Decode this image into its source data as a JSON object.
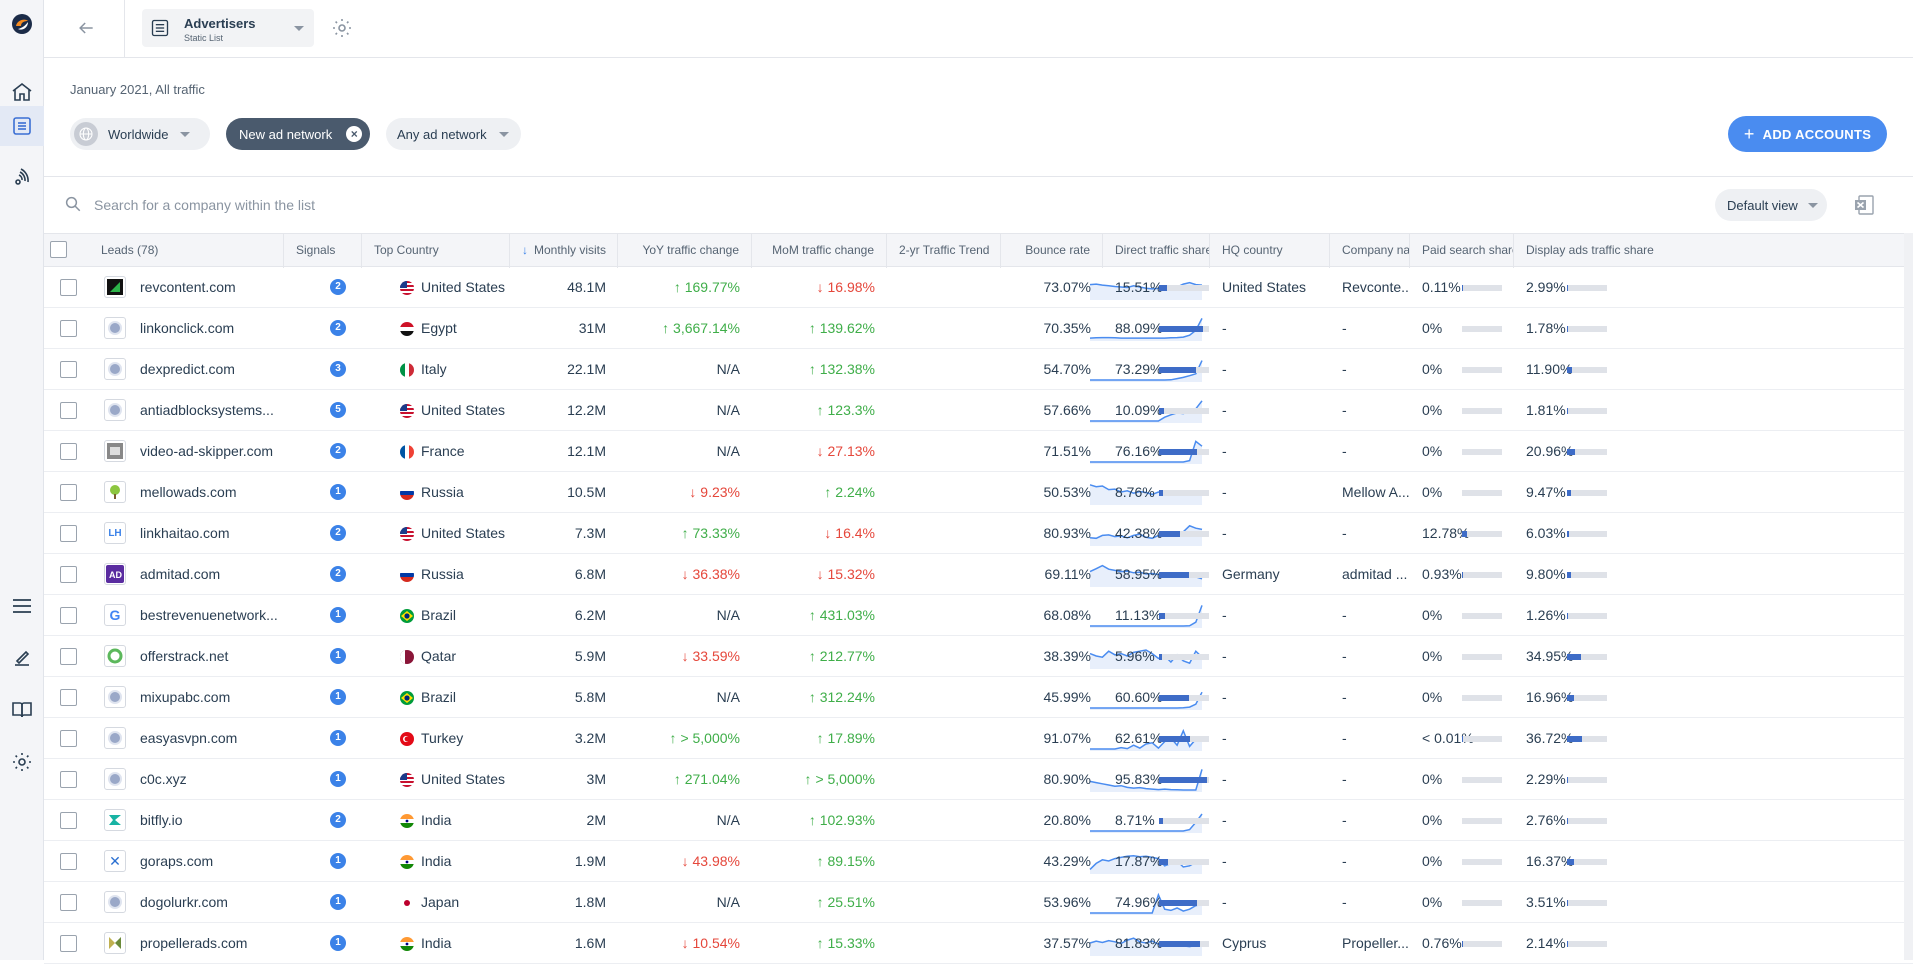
{
  "colors": {
    "accent": "#4a8cf0",
    "up": "#3fae49",
    "down": "#e5473b",
    "bar": "#3e6cc7",
    "signal": "#3b82e8"
  },
  "rail": {
    "icons": [
      "similarweb-logo-icon",
      "home-icon",
      "list-icon",
      "signals-icon",
      "menu-icon",
      "edit-icon",
      "book-icon",
      "settings-icon"
    ]
  },
  "header": {
    "list_title": "Advertisers",
    "list_subtitle": "Static List"
  },
  "filters": {
    "period": "January 2021, All traffic",
    "region": "Worldwide",
    "active_chip": "New ad network",
    "network_select": "Any ad network",
    "add_button": "ADD ACCOUNTS"
  },
  "search": {
    "placeholder": "Search for a company within the list",
    "view": "Default view"
  },
  "columns": {
    "leads": "Leads (78)",
    "signals": "Signals",
    "top_country": "Top Country",
    "monthly_visits": "Monthly visits",
    "yoy": "YoY traffic change",
    "mom": "MoM traffic change",
    "trend": "2-yr Traffic Trend",
    "bounce": "Bounce rate",
    "direct": "Direct traffic share",
    "hq": "HQ country",
    "company": "Company name",
    "paid": "Paid search share",
    "display": "Display ads traffic share"
  },
  "rows": [
    {
      "domain": "revcontent.com",
      "fav": "rc",
      "signals": "2",
      "country": "United States",
      "flag": "us",
      "visits": "48.1M",
      "yoy": "169.77%",
      "yoy_dir": "up",
      "mom": "16.98%",
      "mom_dir": "down",
      "bounce": "73.07%",
      "direct": "15.51%",
      "direct_v": 15.51,
      "hq": "United States",
      "company": "Revconte...",
      "paid": "0.11%",
      "paid_v": 0.11,
      "display": "2.99%",
      "display_v": 2.99,
      "trend": [
        60,
        62,
        58,
        55,
        52,
        50,
        48,
        55,
        50,
        45,
        42,
        44,
        46,
        42,
        50,
        62,
        68,
        60,
        58
      ]
    },
    {
      "domain": "linkonclick.com",
      "fav": "globe",
      "signals": "2",
      "country": "Egypt",
      "flag": "eg",
      "visits": "31M",
      "yoy": "3,667.14%",
      "yoy_dir": "up",
      "mom": "139.62%",
      "mom_dir": "up",
      "bounce": "70.35%",
      "direct": "88.09%",
      "direct_v": 88.09,
      "hq": "-",
      "company": "-",
      "paid": "0%",
      "paid_v": 0,
      "display": "1.78%",
      "display_v": 1.78,
      "trend": [
        8,
        9,
        10,
        10,
        9,
        8,
        8,
        8,
        8,
        8,
        8,
        8,
        8,
        9,
        10,
        12,
        20,
        40,
        90
      ]
    },
    {
      "domain": "dexpredict.com",
      "fav": "globe",
      "signals": "3",
      "country": "Italy",
      "flag": "it",
      "visits": "22.1M",
      "yoy": "N/A",
      "yoy_dir": "na",
      "mom": "132.38%",
      "mom_dir": "up",
      "bounce": "54.70%",
      "direct": "73.29%",
      "direct_v": 73.29,
      "hq": "-",
      "company": "-",
      "paid": "0%",
      "paid_v": 0,
      "display": "11.90%",
      "display_v": 11.9,
      "trend": [
        4,
        4,
        4,
        4,
        4,
        4,
        4,
        4,
        4,
        4,
        4,
        4,
        4,
        5,
        10,
        15,
        22,
        30,
        85
      ]
    },
    {
      "domain": "antiadblocksystems...",
      "fav": "globe",
      "signals": "5",
      "country": "United States",
      "flag": "us",
      "visits": "12.2M",
      "yoy": "N/A",
      "yoy_dir": "na",
      "mom": "123.3%",
      "mom_dir": "up",
      "bounce": "57.66%",
      "direct": "10.09%",
      "direct_v": 10.09,
      "hq": "-",
      "company": "-",
      "paid": "0%",
      "paid_v": 0,
      "display": "1.81%",
      "display_v": 1.81,
      "trend": [
        4,
        4,
        4,
        4,
        4,
        4,
        4,
        4,
        4,
        4,
        4,
        4,
        20,
        30,
        38,
        35,
        45,
        55,
        88
      ]
    },
    {
      "domain": "video-ad-skipper.com",
      "fav": "vid",
      "signals": "2",
      "country": "France",
      "flag": "fr",
      "visits": "12.1M",
      "yoy": "N/A",
      "yoy_dir": "na",
      "mom": "27.13%",
      "mom_dir": "down",
      "bounce": "71.51%",
      "direct": "76.16%",
      "direct_v": 76.16,
      "hq": "-",
      "company": "-",
      "paid": "0%",
      "paid_v": 0,
      "display": "20.96%",
      "display_v": 20.96,
      "trend": [
        4,
        4,
        4,
        4,
        4,
        4,
        4,
        4,
        4,
        4,
        4,
        4,
        4,
        4,
        4,
        4,
        10,
        90,
        70
      ]
    },
    {
      "domain": "mellowads.com",
      "fav": "tree",
      "signals": "1",
      "country": "Russia",
      "flag": "ru",
      "visits": "10.5M",
      "yoy": "9.23%",
      "yoy_dir": "down",
      "mom": "2.24%",
      "mom_dir": "up",
      "bounce": "50.53%",
      "direct": "8.76%",
      "direct_v": 8.76,
      "hq": "-",
      "company": "Mellow A...",
      "paid": "0%",
      "paid_v": 0,
      "display": "9.47%",
      "display_v": 9.47,
      "trend": [
        80,
        72,
        75,
        60,
        62,
        50,
        55,
        45,
        52,
        48,
        40,
        50,
        45,
        55,
        42,
        48,
        44,
        40,
        42
      ]
    },
    {
      "domain": "linkhaitao.com",
      "fav": "LH",
      "signals": "2",
      "country": "United States",
      "flag": "us",
      "visits": "7.3M",
      "yoy": "73.33%",
      "yoy_dir": "up",
      "mom": "16.4%",
      "mom_dir": "down",
      "bounce": "80.93%",
      "direct": "42.38%",
      "direct_v": 42.38,
      "hq": "-",
      "company": "-",
      "paid": "12.78%",
      "paid_v": 12.78,
      "display": "6.03%",
      "display_v": 6.03,
      "trend": [
        30,
        28,
        40,
        42,
        35,
        38,
        30,
        40,
        45,
        32,
        28,
        40,
        50,
        45,
        38,
        55,
        80,
        70,
        65
      ]
    },
    {
      "domain": "admitad.com",
      "fav": "AD",
      "signals": "2",
      "country": "Russia",
      "flag": "ru",
      "visits": "6.8M",
      "yoy": "36.38%",
      "yoy_dir": "down",
      "mom": "15.32%",
      "mom_dir": "down",
      "bounce": "69.11%",
      "direct": "58.95%",
      "direct_v": 58.95,
      "hq": "Germany",
      "company": "admitad ...",
      "paid": "0.93%",
      "paid_v": 0.93,
      "display": "9.80%",
      "display_v": 9.8,
      "trend": [
        60,
        72,
        85,
        70,
        65,
        60,
        62,
        55,
        58,
        50,
        52,
        48,
        50,
        45,
        48,
        42,
        40,
        38,
        30
      ]
    },
    {
      "domain": "bestrevenuenetwork...",
      "fav": "G",
      "signals": "1",
      "country": "Brazil",
      "flag": "br",
      "visits": "6.2M",
      "yoy": "N/A",
      "yoy_dir": "na",
      "mom": "431.03%",
      "mom_dir": "up",
      "bounce": "68.08%",
      "direct": "11.13%",
      "direct_v": 11.13,
      "hq": "-",
      "company": "-",
      "paid": "0%",
      "paid_v": 0,
      "display": "1.26%",
      "display_v": 1.26,
      "trend": [
        4,
        4,
        4,
        4,
        4,
        4,
        4,
        4,
        4,
        4,
        4,
        4,
        4,
        4,
        4,
        4,
        5,
        20,
        90
      ]
    },
    {
      "domain": "offerstrack.net",
      "fav": "ring",
      "signals": "1",
      "country": "Qatar",
      "flag": "qa",
      "visits": "5.9M",
      "yoy": "33.59%",
      "yoy_dir": "down",
      "mom": "212.77%",
      "mom_dir": "up",
      "bounce": "38.39%",
      "direct": "5.96%",
      "direct_v": 5.96,
      "hq": "-",
      "company": "-",
      "paid": "0%",
      "paid_v": 0,
      "display": "34.95%",
      "display_v": 34.95,
      "trend": [
        60,
        50,
        45,
        70,
        55,
        60,
        50,
        65,
        70,
        75,
        60,
        40,
        50,
        25,
        55,
        30,
        20,
        70,
        45
      ]
    },
    {
      "domain": "mixupabc.com",
      "fav": "globe",
      "signals": "1",
      "country": "Brazil",
      "flag": "br",
      "visits": "5.8M",
      "yoy": "N/A",
      "yoy_dir": "na",
      "mom": "312.24%",
      "mom_dir": "up",
      "bounce": "45.99%",
      "direct": "60.60%",
      "direct_v": 60.6,
      "hq": "-",
      "company": "-",
      "paid": "0%",
      "paid_v": 0,
      "display": "16.96%",
      "display_v": 16.96,
      "trend": [
        4,
        4,
        4,
        4,
        4,
        4,
        4,
        4,
        4,
        4,
        4,
        4,
        4,
        4,
        4,
        5,
        8,
        20,
        70
      ]
    },
    {
      "domain": "easyasvpn.com",
      "fav": "globe",
      "signals": "1",
      "country": "Turkey",
      "flag": "tr",
      "visits": "3.2M",
      "yoy": "> 5,000%",
      "yoy_dir": "up",
      "mom": "17.89%",
      "mom_dir": "up",
      "bounce": "91.07%",
      "direct": "62.61%",
      "direct_v": 62.61,
      "hq": "-",
      "company": "-",
      "paid": "< 0.01%",
      "paid_v": 0.01,
      "display": "36.72%",
      "display_v": 36.72,
      "trend": [
        4,
        4,
        4,
        4,
        4,
        10,
        6,
        20,
        8,
        25,
        30,
        8,
        35,
        50,
        20,
        80,
        15,
        45,
        50
      ]
    },
    {
      "domain": "c0c.xyz",
      "fav": "globe",
      "signals": "1",
      "country": "United States",
      "flag": "us",
      "visits": "3M",
      "yoy": "271.04%",
      "yoy_dir": "up",
      "mom": "> 5,000%",
      "mom_dir": "up",
      "bounce": "80.90%",
      "direct": "95.83%",
      "direct_v": 95.83,
      "hq": "-",
      "company": "-",
      "paid": "0%",
      "paid_v": 0,
      "display": "2.29%",
      "display_v": 2.29,
      "trend": [
        40,
        35,
        30,
        25,
        20,
        22,
        15,
        12,
        14,
        10,
        8,
        6,
        8,
        6,
        5,
        4,
        4,
        4,
        90
      ]
    },
    {
      "domain": "bitfly.io",
      "fav": "bf",
      "signals": "2",
      "country": "India",
      "flag": "in",
      "visits": "2M",
      "yoy": "N/A",
      "yoy_dir": "na",
      "mom": "102.93%",
      "mom_dir": "up",
      "bounce": "20.80%",
      "direct": "8.71%",
      "direct_v": 8.71,
      "hq": "-",
      "company": "-",
      "paid": "0%",
      "paid_v": 0,
      "display": "2.76%",
      "display_v": 2.76,
      "trend": [
        4,
        4,
        4,
        4,
        4,
        4,
        4,
        4,
        4,
        4,
        4,
        4,
        4,
        4,
        4,
        4,
        10,
        40,
        75
      ]
    },
    {
      "domain": "goraps.com",
      "fav": "X",
      "signals": "1",
      "country": "India",
      "flag": "in",
      "visits": "1.9M",
      "yoy": "43.98%",
      "yoy_dir": "down",
      "mom": "89.15%",
      "mom_dir": "up",
      "bounce": "43.29%",
      "direct": "17.87%",
      "direct_v": 17.87,
      "hq": "-",
      "company": "-",
      "paid": "0%",
      "paid_v": 0,
      "display": "16.37%",
      "display_v": 16.37,
      "trend": [
        15,
        40,
        55,
        50,
        60,
        65,
        70,
        72,
        68,
        70,
        65,
        60,
        30,
        40,
        50,
        25,
        30,
        45,
        40
      ]
    },
    {
      "domain": "dogolurkr.com",
      "fav": "globe",
      "signals": "1",
      "country": "Japan",
      "flag": "jp",
      "visits": "1.8M",
      "yoy": "N/A",
      "yoy_dir": "na",
      "mom": "25.51%",
      "mom_dir": "up",
      "bounce": "53.96%",
      "direct": "74.96%",
      "direct_v": 74.96,
      "hq": "-",
      "company": "-",
      "paid": "0%",
      "paid_v": 0,
      "display": "3.51%",
      "display_v": 3.51,
      "trend": [
        4,
        4,
        4,
        4,
        4,
        4,
        4,
        4,
        4,
        4,
        4,
        80,
        20,
        15,
        25,
        12,
        20,
        35,
        40
      ]
    },
    {
      "domain": "propellerads.com",
      "fav": "prop",
      "signals": "1",
      "country": "India",
      "flag": "in",
      "visits": "1.6M",
      "yoy": "10.54%",
      "yoy_dir": "down",
      "mom": "15.33%",
      "mom_dir": "up",
      "bounce": "37.57%",
      "direct": "81.83%",
      "direct_v": 81.83,
      "hq": "Cyprus",
      "company": "Propeller...",
      "paid": "0.76%",
      "paid_v": 0.76,
      "display": "2.14%",
      "display_v": 2.14,
      "trend": [
        50,
        58,
        52,
        60,
        55,
        48,
        62,
        70,
        55,
        50,
        58,
        45,
        50,
        40,
        45,
        38,
        35,
        40,
        45
      ]
    }
  ]
}
